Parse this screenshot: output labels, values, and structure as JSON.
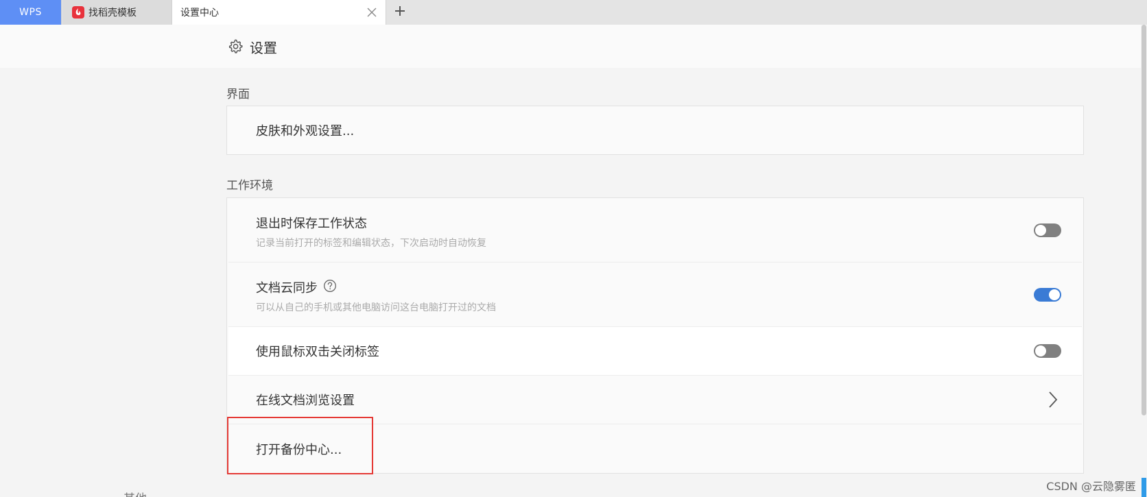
{
  "tabs": {
    "wps_label": "WPS",
    "template_label": "找稻壳模板",
    "settings_label": "设置中心"
  },
  "header": {
    "title": "设置"
  },
  "sections": {
    "interface": {
      "label": "界面",
      "skin_label": "皮肤和外观设置..."
    },
    "workspace": {
      "label": "工作环境",
      "rows": {
        "save_state": {
          "title": "退出时保存工作状态",
          "desc": "记录当前打开的标签和编辑状态，下次启动时自动恢复",
          "enabled": false
        },
        "cloud_sync": {
          "title": "文档云同步",
          "desc": "可以从自己的手机或其他电脑访问这台电脑打开过的文档",
          "enabled": true
        },
        "dblclick_close": {
          "title": "使用鼠标双击关闭标签",
          "enabled": false
        },
        "online_browse": {
          "title": "在线文档浏览设置"
        },
        "backup_center": {
          "title": "打开备份中心..."
        }
      }
    },
    "next_partial": "其他"
  },
  "colors": {
    "accent": "#3a7bd5",
    "wps_tab": "#5e8ff5",
    "highlight": "#e53935",
    "toggle_off": "#808080"
  },
  "watermark": "CSDN @云隐雾匿"
}
